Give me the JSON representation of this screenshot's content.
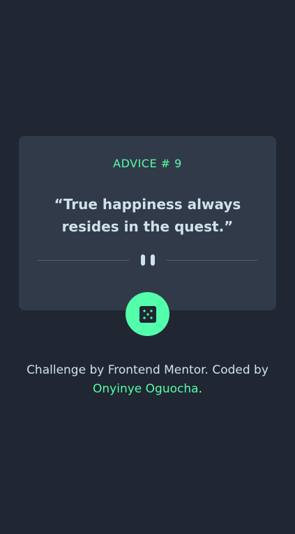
{
  "card": {
    "advice_label": "ADVICE # 9",
    "quote": "“True happiness always resides in the quest.”"
  },
  "dice_button": {
    "icon": "dice-icon"
  },
  "footer": {
    "prefix": "Challenge by Frontend Mentor. Coded by",
    "author_link": "Onyinye Oguocha",
    "suffix": "."
  },
  "colors": {
    "background": "#202632",
    "card": "#313a48",
    "accent": "#53ffaa",
    "text": "#cee3e9",
    "divider": "#4f5d74"
  }
}
